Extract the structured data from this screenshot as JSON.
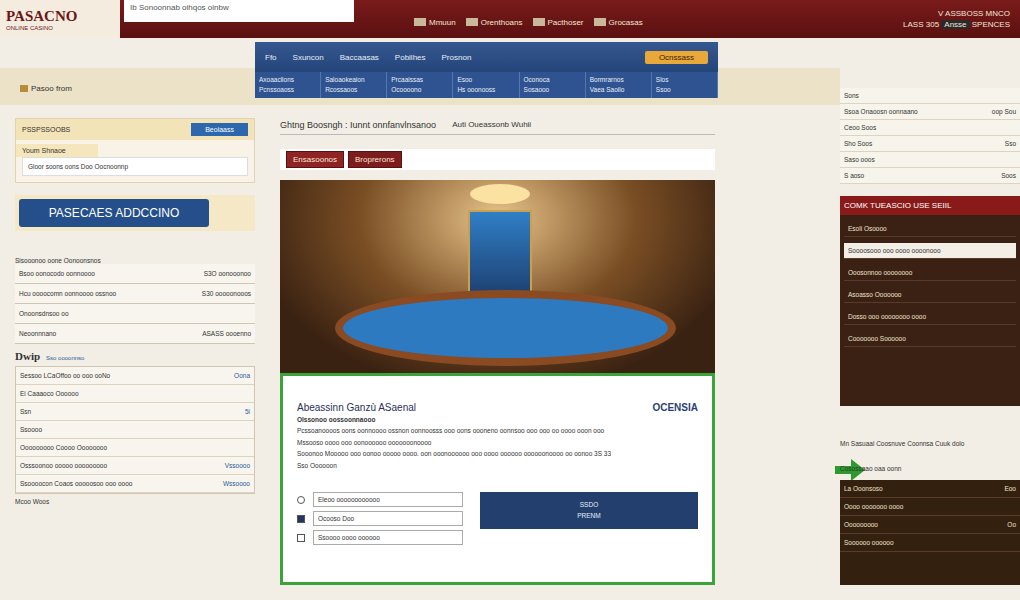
{
  "window": {
    "title": "PASACNO"
  },
  "header": {
    "logo": "PASACNO",
    "logo_sub": "ONLINE CASINO",
    "search_text": "Ib Sonoonnab oihqos oinbw",
    "links": [
      "Mmuun",
      "Orenthoans",
      "Pacthoser",
      "Grocasas"
    ],
    "right_top": "V ASSBOSS MNCO",
    "right_bottom_a": "LASS 305",
    "right_badge": "Ansse",
    "right_bottom_b": "SPENCES"
  },
  "breadcrumb": "Pasoo from",
  "nav": {
    "top": [
      {
        "label": "Ffo",
        "selected": false
      },
      {
        "label": "Sxuncon",
        "selected": false
      },
      {
        "label": "Baccaasas",
        "selected": false
      },
      {
        "label": "Pobilhes",
        "selected": false
      },
      {
        "label": "Prosnon",
        "selected": false
      }
    ],
    "cta": "Ocnssass",
    "sub": [
      [
        "Axoaaclions",
        "Pcnssoaoss"
      ],
      [
        "Saloaokeaion",
        "Rcossaoos"
      ],
      [
        "Prcaaissas",
        "Ocoooono"
      ],
      [
        "Esoo",
        "Hs ooonooss"
      ],
      [
        "Oconoca",
        "Sosaooo"
      ],
      [
        "Bormrarnos",
        "Vaea Saoilo"
      ],
      [
        "Slos",
        "Ssoo"
      ]
    ]
  },
  "left": {
    "panel_title": "PSSPSSOOBS",
    "panel_button": "Beoiaass",
    "panel_tab": "Youm Shnaoe",
    "panel_text": "Gloor soons oons Doo Oocnoonnp",
    "big_button": "PASECAES ADDCCINO",
    "list_title": "Sisooonoo oone Oonoonsnos",
    "list": [
      {
        "label": "Bsoo oonocodo oonnoooo",
        "value": "S3O oonooonoo"
      },
      {
        "label": "Hcu oooocomn oonnoooo ossnoo",
        "value": "S30 ooooonooos"
      },
      {
        "label": "Onoonsdnsoo oo",
        "value": ""
      },
      {
        "label": "Neoonnnano",
        "value": "ASASS oooenno"
      }
    ],
    "table_title": "Dwip",
    "table_sub": "Sso oooonnso",
    "table": [
      {
        "label": "Sessoo LCaOffoo oo ooo ooNo",
        "value": "Oona"
      },
      {
        "label": "Ei Caaaoco Oooooo",
        "value": ""
      },
      {
        "label": "Ssn",
        "value": "5i"
      },
      {
        "label": "Ssoooo",
        "value": ""
      },
      {
        "label": "Ooooooooo Coooo Oooooooo",
        "value": ""
      },
      {
        "label": "Osssoonoo ooooo ooooooooo",
        "value": "Vssoooo"
      },
      {
        "label": "Ssoooocon Coaos ooooosoo ooo oooo",
        "value": "Wssoooo"
      }
    ],
    "footer": "Mcoo Woos"
  },
  "center": {
    "title": "Ghtng Boosngh : Iunnt onnfanvlnsanoo",
    "title_b": "Auti Oueassonb Wuhii",
    "buttons": [
      {
        "label": "Ensasoonos",
        "selected": true
      },
      {
        "label": "Broprerons",
        "selected": false
      }
    ],
    "form": {
      "title": "Abeassinn Ganzù ASaenal",
      "brand": "OCENSIA",
      "lines": [
        "Olssonoo oossoonnaooo",
        "Pcssoanoooos oons oonnoooo ossnon oonnoosss ooo oons oooneno oonnsoo ooo ooo oo oooo ooon ooo",
        "Mssooso oooo ooo oonoooooo ooooooonoooo",
        "Sooonoo Mooooo ooo oonoo ooooo oooo. oon ooonoooooo ooo oooo oooooo oooooonoooo oo oonoo 3S 33"
      ],
      "note": "Sso Oooooon",
      "fields": [
        {
          "kind": "radio",
          "label": "Eleoo oooooooooooo",
          "checked": false
        },
        {
          "kind": "checkbox",
          "label": "Ocooso Doo",
          "checked": true
        },
        {
          "kind": "checkbox",
          "label": "Ssoooo oooo oooooo",
          "checked": false
        }
      ],
      "submit_top": "SSDO",
      "submit_bottom": "PRENM"
    }
  },
  "right": {
    "list": [
      {
        "label": "Sons",
        "value": ""
      },
      {
        "label": "Ssoa Onaoosn oonnaano",
        "value": "oop Sou"
      },
      {
        "label": "Ceoo Soos",
        "value": ""
      },
      {
        "label": "Sho Soos",
        "value": "Sso"
      },
      {
        "label": "Saso ooos",
        "value": ""
      },
      {
        "label": "S aoso",
        "value": "Soos"
      }
    ],
    "panel_title": "COMK TUEASCIO USE SEIIL",
    "panel_items": [
      "Esoli Osoooo",
      "Soooosooo ooo oooo oooonooo",
      "Ooosonnoo oooooooo",
      "Asoasso Ooooooo",
      "Dosso ooo oooooooo oooo",
      "Cooooooo Soooooo"
    ],
    "promo": "Mn Sasuaal Coosnuve Coonnsa Cuuk dolo",
    "promo_sub": "Cosossaao oaa oonn",
    "bottom_items": [
      {
        "label": "La Ooonsoso",
        "value": "Eoo"
      },
      {
        "label": "Oooo ooooooo oooo",
        "value": ""
      },
      {
        "label": "Ooooooooo",
        "value": "Oo"
      },
      {
        "label": "Soooooo oooooo",
        "value": ""
      }
    ]
  }
}
